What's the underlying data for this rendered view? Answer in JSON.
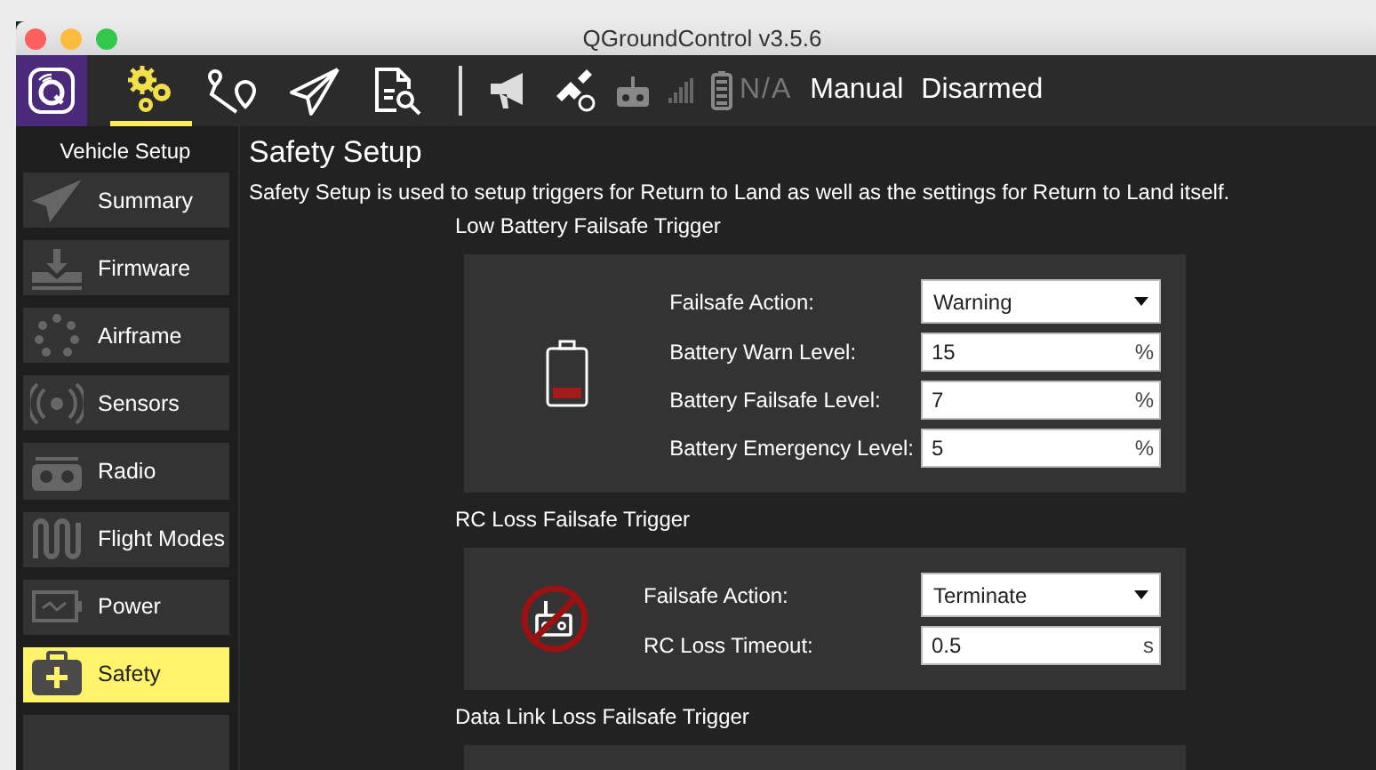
{
  "window": {
    "title": "QGroundControl v3.5.6"
  },
  "toolbar": {
    "items": [
      {
        "kind": "logo"
      },
      {
        "kind": "setup",
        "selected": true
      },
      {
        "kind": "plan",
        "selected": false
      },
      {
        "kind": "fly",
        "selected": false
      },
      {
        "kind": "analyze",
        "selected": false
      }
    ],
    "status": {
      "battery": "N/A",
      "flight_mode": "Manual",
      "arm_state": "Disarmed"
    }
  },
  "sidebar": {
    "title": "Vehicle Setup",
    "items": [
      {
        "kind": "summary",
        "label": "Summary",
        "selected": false
      },
      {
        "kind": "firmware",
        "label": "Firmware",
        "selected": false
      },
      {
        "kind": "airframe",
        "label": "Airframe",
        "selected": false
      },
      {
        "kind": "sensors",
        "label": "Sensors",
        "selected": false
      },
      {
        "kind": "radio",
        "label": "Radio",
        "selected": false
      },
      {
        "kind": "flight_modes",
        "label": "Flight Modes",
        "selected": false
      },
      {
        "kind": "power",
        "label": "Power",
        "selected": false
      },
      {
        "kind": "safety",
        "label": "Safety",
        "selected": true
      }
    ]
  },
  "page": {
    "title": "Safety Setup",
    "description": "Safety Setup is used to setup triggers for Return to Land as well as the settings for Return to Land itself.",
    "sections": [
      {
        "title": "Low Battery Failsafe Trigger",
        "kind": "battery",
        "fields": [
          {
            "kind": "dropdown",
            "label": "Failsafe Action:",
            "value": "Warning"
          },
          {
            "kind": "number",
            "label": "Battery Warn Level:",
            "value": "15",
            "unit": "%"
          },
          {
            "kind": "number",
            "label": "Battery Failsafe Level:",
            "value": "7",
            "unit": "%"
          },
          {
            "kind": "number",
            "label": "Battery Emergency Level:",
            "value": "5",
            "unit": "%"
          }
        ]
      },
      {
        "title": "RC Loss Failsafe Trigger",
        "kind": "rc_loss",
        "fields": [
          {
            "kind": "dropdown",
            "label": "Failsafe Action:",
            "value": "Terminate"
          },
          {
            "kind": "number",
            "label": "RC Loss Timeout:",
            "value": "0.5",
            "unit": "s"
          }
        ]
      },
      {
        "title": "Data Link Loss Failsafe Trigger"
      }
    ]
  }
}
